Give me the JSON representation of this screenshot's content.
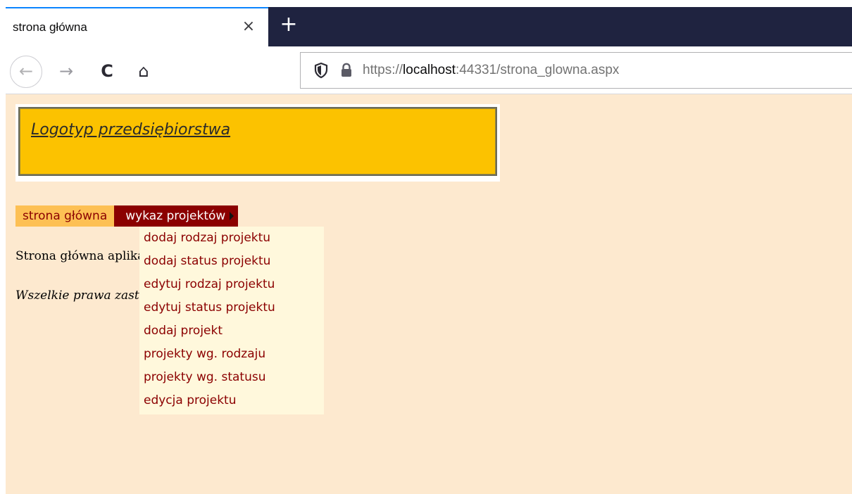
{
  "browser": {
    "tab_title": "strona główna",
    "tab_close_label": "×",
    "new_tab_label": "+",
    "url_prefix": "https://",
    "url_host": "localhost",
    "url_rest": ":44331/strona_glowna.aspx",
    "nav": {
      "back_icon": "back-arrow-icon",
      "forward_icon": "forward-arrow-icon",
      "reload_icon": "reload-icon",
      "home_icon": "home-icon",
      "back_glyph": "←",
      "forward_glyph": "→",
      "reload_glyph": "C",
      "home_glyph": "⌂"
    },
    "colors": {
      "tabbar": "#1f2340",
      "tab_accent": "#0a84ff"
    }
  },
  "page": {
    "logo_text": "Logotyp przedsiębiorstwa",
    "menu": {
      "home_label": "strona główna",
      "projects_label": "wykaz projektów",
      "submenu_items": [
        "dodaj rodzaj projektu",
        "dodaj status projektu",
        "edytuj rodzaj projektu",
        "edytuj status projektu",
        "dodaj projekt",
        "projekty wg. rodzaju",
        "projekty wg. statusu",
        "edycja projektu"
      ]
    },
    "body_text": "Strona główna aplikacji",
    "footer_text": "Wszelkie prawa zastrzeżone",
    "colors": {
      "background": "#fde9cf",
      "logo_fill": "#fcc200",
      "menu_home_bg": "#fdc054",
      "menu_active_bg": "#8b0000",
      "dropdown_bg": "#fff8dc",
      "link_color": "#8b0000"
    }
  }
}
